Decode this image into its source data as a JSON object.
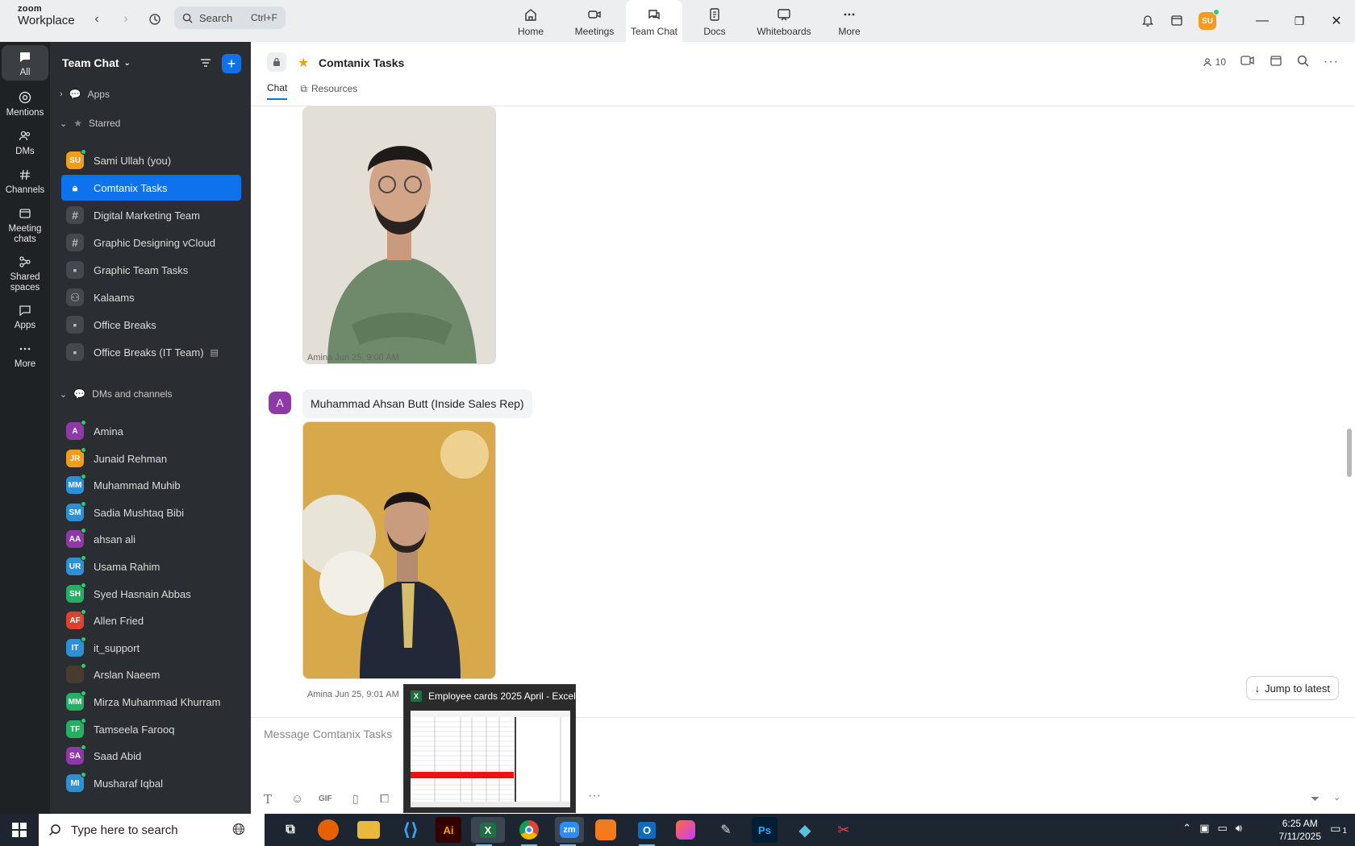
{
  "app": {
    "logo_top": "zoom",
    "logo_bottom": "Workplace",
    "search_label": "Search",
    "search_hint": "Ctrl+F",
    "tabs": [
      {
        "label": "Home"
      },
      {
        "label": "Meetings"
      },
      {
        "label": "Team Chat"
      },
      {
        "label": "Docs"
      },
      {
        "label": "Whiteboards"
      },
      {
        "label": "More"
      }
    ],
    "user_initials": "SU"
  },
  "rail": {
    "items": [
      {
        "label": "All"
      },
      {
        "label": "Mentions"
      },
      {
        "label": "DMs"
      },
      {
        "label": "Channels"
      },
      {
        "label": "Meeting chats"
      },
      {
        "label": "Shared spaces"
      },
      {
        "label": "Apps"
      },
      {
        "label": "More"
      }
    ]
  },
  "sidebar": {
    "title": "Team Chat",
    "sections": {
      "apps": "Apps",
      "starred": "Starred",
      "dms": "DMs and channels"
    },
    "starred": [
      {
        "label": "Sami Ullah (you)",
        "initials": "SU",
        "color": "#f29c1f"
      },
      {
        "label": "Comtanix Tasks"
      },
      {
        "label": "Digital Marketing Team"
      },
      {
        "label": "Graphic Designing vCloud"
      },
      {
        "label": "Graphic Team Tasks"
      },
      {
        "label": "Kalaams"
      },
      {
        "label": "Office Breaks"
      },
      {
        "label": "Office Breaks (IT Team)"
      }
    ],
    "dms": [
      {
        "label": "Amina",
        "initials": "A",
        "color": "#8e3aa6"
      },
      {
        "label": "Junaid Rehman",
        "initials": "JR",
        "color": "#f29c1f"
      },
      {
        "label": "Muhammad Muhib",
        "initials": "MM",
        "color": "#2d8fd5"
      },
      {
        "label": "Sadia Mushtaq Bibi",
        "initials": "SM",
        "color": "#2d8fd5"
      },
      {
        "label": "ahsan ali",
        "initials": "AA",
        "color": "#8e3aa6"
      },
      {
        "label": "Usama Rahim",
        "initials": "UR",
        "color": "#2d8fd5"
      },
      {
        "label": "Syed Hasnain Abbas",
        "initials": "SH",
        "color": "#27ae60"
      },
      {
        "label": "Allen Fried",
        "initials": "AF",
        "color": "#d9432f"
      },
      {
        "label": "it_support",
        "initials": "IT",
        "color": "#2d8fd5"
      },
      {
        "label": "Arslan Naeem",
        "initials": "",
        "color": "#4a3b2f"
      },
      {
        "label": "Mirza Muhammad Khurram",
        "initials": "MM",
        "color": "#27ae60"
      },
      {
        "label": "Tamseela Farooq",
        "initials": "TF",
        "color": "#27ae60"
      },
      {
        "label": "Saad Abid",
        "initials": "SA",
        "color": "#8e3aa6"
      },
      {
        "label": "Musharaf Iqbal",
        "initials": "MI",
        "color": "#2d8fd5"
      }
    ]
  },
  "channel": {
    "title": "Comtanix Tasks",
    "members": "10",
    "tabs": [
      "Chat",
      "Resources"
    ],
    "messages": [
      {
        "sender": "Amina",
        "time": "Jun 25, 9:00 AM",
        "text": "Muhammad Ahsan Butt (Inside Sales Rep)",
        "avatar": "A"
      },
      {
        "sender": "Amina",
        "time": "Jun 25, 9:01 AM"
      }
    ],
    "jump_label": "Jump to latest",
    "composer_placeholder": "Message Comtanix Tasks"
  },
  "popup": {
    "title": "Employee cards 2025 April - Excel"
  },
  "taskbar": {
    "search_placeholder": "Type here to search",
    "time": "6:25 AM",
    "date": "7/11/2025",
    "notif_count": "1"
  }
}
